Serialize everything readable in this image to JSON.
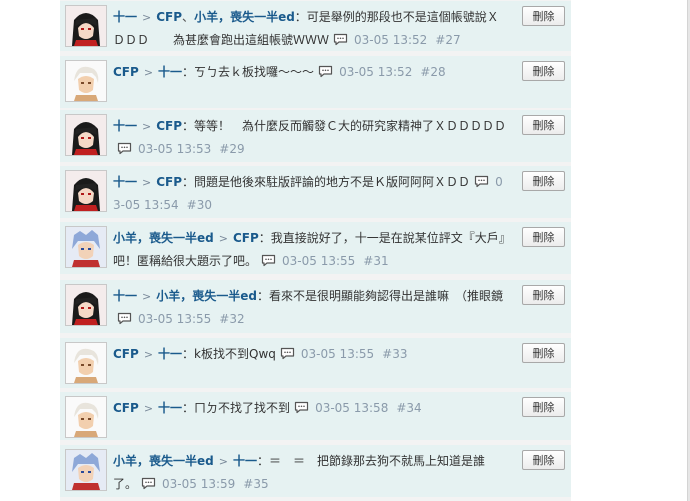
{
  "comments": [
    {
      "avatar": "avatar-black-hair-girl",
      "segments": [
        {
          "type": "user",
          "text": "十一"
        },
        {
          "type": "sep",
          "text": ">"
        },
        {
          "type": "user",
          "text": "CFP"
        },
        {
          "type": "pun",
          "text": "、"
        },
        {
          "type": "user",
          "text": "小羊，喪失一半ed"
        },
        {
          "type": "text",
          "text": "：可是舉例的那段也不是這個帳號說ＸＤＤＤ　　為甚麼會跑出這組帳號ＷＷＷ"
        }
      ],
      "time": "03-05 13:52",
      "floor": "#27",
      "delete_label": "刪除"
    },
    {
      "avatar": "avatar-white-hair-boy",
      "segments": [
        {
          "type": "user",
          "text": "CFP"
        },
        {
          "type": "sep",
          "text": ">"
        },
        {
          "type": "user",
          "text": "十一"
        },
        {
          "type": "text",
          "text": "：ㄎㄅ去ｋ板找囉～～～"
        }
      ],
      "time": "03-05 13:52",
      "floor": "#28",
      "delete_label": "刪除"
    },
    {
      "avatar": "avatar-black-hair-girl",
      "segments": [
        {
          "type": "user",
          "text": "十一"
        },
        {
          "type": "sep",
          "text": ">"
        },
        {
          "type": "user",
          "text": "CFP"
        },
        {
          "type": "text",
          "text": "：等等！　為什麼反而觸發Ｃ大的研究家精神了ＸＤＤＤＤＤ"
        }
      ],
      "time": "03-05 13:53",
      "floor": "#29",
      "delete_label": "刪除"
    },
    {
      "avatar": "avatar-black-hair-girl",
      "segments": [
        {
          "type": "user",
          "text": "十一"
        },
        {
          "type": "sep",
          "text": ">"
        },
        {
          "type": "user",
          "text": "CFP"
        },
        {
          "type": "text",
          "text": "：問題是他後來駐版評論的地方不是Ｋ版阿阿阿ＸＤＤ"
        }
      ],
      "time": "03-05 13:54",
      "floor": "#30",
      "delete_label": "刪除"
    },
    {
      "avatar": "avatar-blue-hair-boy",
      "segments": [
        {
          "type": "user",
          "text": "小羊，喪失一半ed"
        },
        {
          "type": "sep",
          "text": ">"
        },
        {
          "type": "user",
          "text": "CFP"
        },
        {
          "type": "text",
          "text": "：我直接說好了，十一是在說某位評文『大戶』吧！匿稱給很大題示了吧。"
        }
      ],
      "time": "03-05 13:55",
      "floor": "#31",
      "delete_label": "刪除"
    },
    {
      "avatar": "avatar-black-hair-girl",
      "segments": [
        {
          "type": "user",
          "text": "十一"
        },
        {
          "type": "sep",
          "text": ">"
        },
        {
          "type": "user",
          "text": "小羊，喪失一半ed"
        },
        {
          "type": "text",
          "text": "：看來不是很明顯能夠認得出是誰嘛　（推眼鏡"
        }
      ],
      "time": "03-05 13:55",
      "floor": "#32",
      "delete_label": "刪除"
    },
    {
      "avatar": "avatar-white-hair-boy",
      "segments": [
        {
          "type": "user",
          "text": "CFP"
        },
        {
          "type": "sep",
          "text": ">"
        },
        {
          "type": "user",
          "text": "十一"
        },
        {
          "type": "text",
          "text": "：k板找不到Qwq"
        }
      ],
      "time": "03-05 13:55",
      "floor": "#33",
      "delete_label": "刪除"
    },
    {
      "avatar": "avatar-white-hair-boy",
      "segments": [
        {
          "type": "user",
          "text": "CFP"
        },
        {
          "type": "sep",
          "text": ">"
        },
        {
          "type": "user",
          "text": "十一"
        },
        {
          "type": "text",
          "text": "：ㄇㄉ不找了找不到"
        }
      ],
      "time": "03-05 13:58",
      "floor": "#34",
      "delete_label": "刪除"
    },
    {
      "avatar": "avatar-blue-hair-boy",
      "segments": [
        {
          "type": "user",
          "text": "小羊，喪失一半ed"
        },
        {
          "type": "sep",
          "text": ">"
        },
        {
          "type": "user",
          "text": "十一"
        },
        {
          "type": "text",
          "text": "：＝　＝　把節錄那去狗不就馬上知道是誰了。"
        }
      ],
      "time": "03-05 13:59",
      "floor": "#35",
      "delete_label": "刪除"
    }
  ],
  "colors": {
    "card_bg": "#e6f2f2",
    "user": "#1a5a8c",
    "meta": "#8a9aaa",
    "feed_bg": "#f3f3f3"
  }
}
